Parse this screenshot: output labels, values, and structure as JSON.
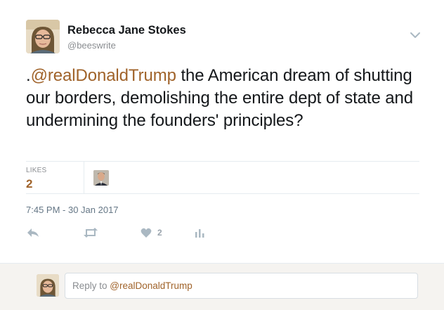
{
  "author": {
    "name": "Rebecca Jane Stokes",
    "handle": "@beeswrite"
  },
  "tweet": {
    "prefix": ".",
    "mention": "@realDonaldTrump",
    "text": " the American dream of shutting our borders, demolishing the entire dept of state and undermining the founders' principles?"
  },
  "stats": {
    "likes_label": "LIKES",
    "likes_count": "2"
  },
  "timestamp": "7:45 PM - 30 Jan 2017",
  "actions": {
    "like_count": "2"
  },
  "reply": {
    "placeholder_prefix": "Reply to ",
    "placeholder_mention": "@realDonaldTrump"
  },
  "colors": {
    "link": "#a0632a",
    "muted": "#8a8d91",
    "action_icon": "#aab8c2",
    "reply_bar_bg": "#f5f3f0"
  }
}
